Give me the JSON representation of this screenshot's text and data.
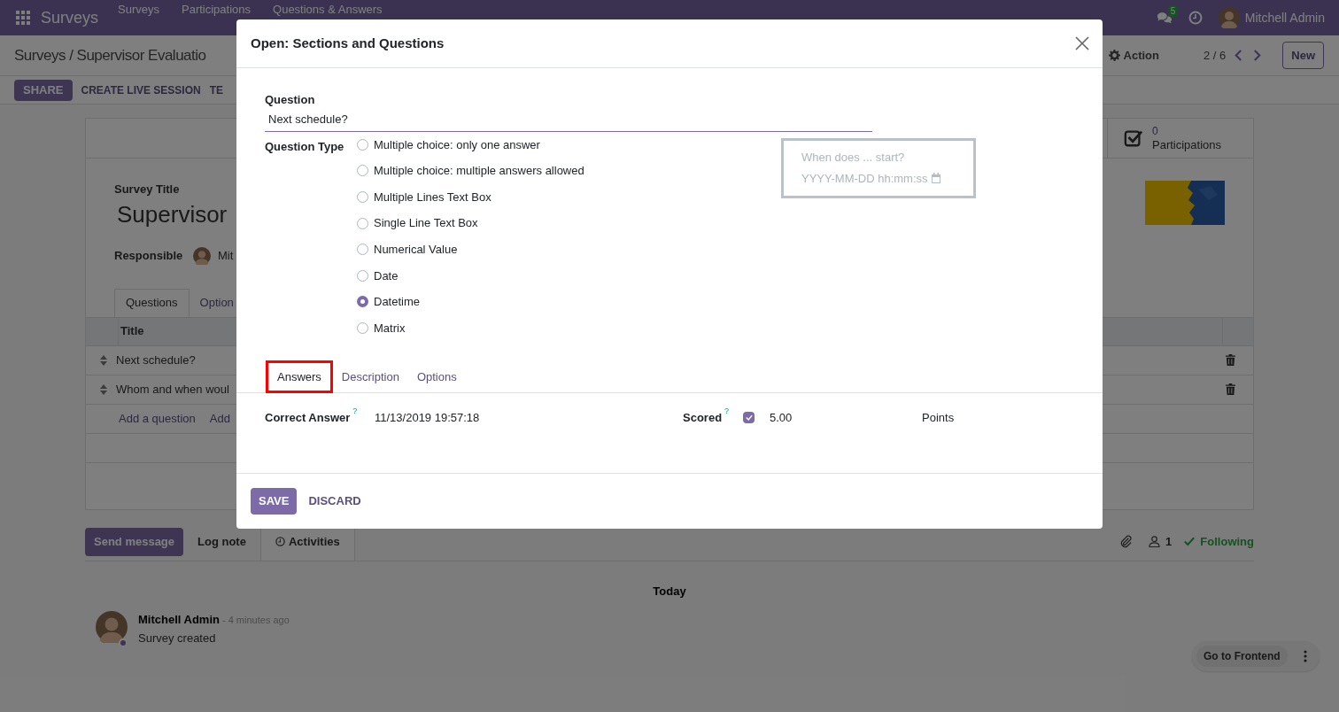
{
  "navbar": {
    "app_name": "Surveys",
    "menu": [
      "Surveys",
      "Participations",
      "Questions & Answers"
    ],
    "messages_count": "5",
    "user": "Mitchell Admin"
  },
  "breadcrumb": "Surveys / Supervisor Evaluatio",
  "control_panel": {
    "buttons": [
      {
        "label": "SHARE",
        "kind": "primary"
      },
      {
        "label": "CREATE LIVE SESSION",
        "kind": "link"
      },
      {
        "label": "TE",
        "kind": "link"
      }
    ],
    "action": "Action",
    "pager": "2 / 6",
    "new_button": "New"
  },
  "form": {
    "stat": {
      "value": "0",
      "label": "Participations"
    },
    "title_label": "Survey Title",
    "title": "Supervisor",
    "responsible_label": "Responsible",
    "responsible": "Mit",
    "tabs": [
      {
        "label": "Questions",
        "selected": true
      },
      {
        "label": "Option",
        "selected": false
      }
    ],
    "table": {
      "columns": [
        "Title"
      ],
      "rows": [
        "Next schedule?",
        "Whom and when woul"
      ],
      "add_links": [
        "Add a question",
        "Add"
      ]
    }
  },
  "chatter": {
    "buttons": [
      {
        "label": "Send message",
        "kind": "primary"
      },
      {
        "label": "Log note",
        "kind": "plain"
      },
      {
        "label": "Activities",
        "kind": "tab"
      }
    ],
    "followers": "1",
    "follow": "Following",
    "date": "Today",
    "message": {
      "author": "Mitchell Admin",
      "time": "- 4 minutes ago",
      "body": "Survey created"
    }
  },
  "frontend_button": "Go to Frontend",
  "dialog": {
    "title": "Open: Sections and Questions",
    "question_label": "Question",
    "question_value": "Next schedule?",
    "type_label": "Question Type",
    "question_types": [
      {
        "label": "Multiple choice: only one answer",
        "selected": false
      },
      {
        "label": "Multiple choice: multiple answers allowed",
        "selected": false
      },
      {
        "label": "Multiple Lines Text Box",
        "selected": false
      },
      {
        "label": "Single Line Text Box",
        "selected": false
      },
      {
        "label": "Numerical Value",
        "selected": false
      },
      {
        "label": "Date",
        "selected": false
      },
      {
        "label": "Datetime",
        "selected": true
      },
      {
        "label": "Matrix",
        "selected": false
      }
    ],
    "preview": {
      "label": "When does ... start?",
      "placeholder": "YYYY-MM-DD hh:mm:ss"
    },
    "tabs": [
      {
        "label": "Answers",
        "selected": true,
        "highlighted": true
      },
      {
        "label": "Description",
        "selected": false,
        "highlighted": false
      },
      {
        "label": "Options",
        "selected": false,
        "highlighted": false
      }
    ],
    "answers": {
      "correct_label": "Correct Answer",
      "correct_help": "?",
      "correct_value": "11/13/2019 19:57:18",
      "scored_label": "Scored",
      "scored_help": "?",
      "scored_checked": true,
      "score": "5.00",
      "unit": "Points"
    },
    "buttons": [
      {
        "label": "SAVE",
        "kind": "primary"
      },
      {
        "label": "DISCARD",
        "kind": "link"
      }
    ]
  }
}
